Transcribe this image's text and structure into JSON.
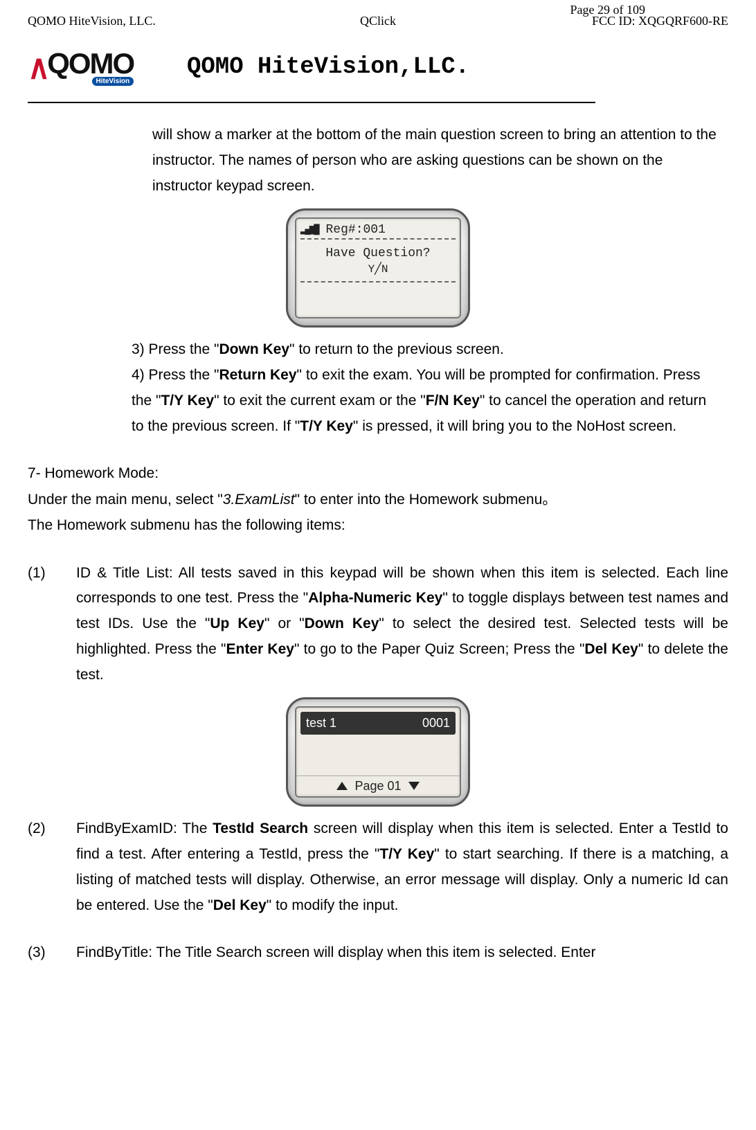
{
  "header": {
    "page_label": "Page ",
    "page_num": "29 of 109",
    "left": "QOMO HiteVision, LLC.",
    "center": "QClick",
    "right": "FCC ID: XQGQRF600-RE",
    "logo_main": "QOMO",
    "logo_sub": "HiteVision",
    "company_title": "QOMO HiteVision,LLC."
  },
  "intro_continued": "will show a marker at the bottom of the main question screen to bring an attention to the instructor. The names of person who are asking questions can be shown on the instructor keypad screen.",
  "screen1": {
    "top_signal": "▂▄▆█",
    "top_label": "Reg#:001",
    "line1": "Have  Question?",
    "line2": "Y╱N"
  },
  "step3_pre": "3) Press the \"",
  "step3_bold": "Down Key",
  "step3_post": "\" to return to the previous screen.",
  "step4": {
    "t1": " 4) Press the \"",
    "b1": "Return Key",
    "t2": "\" to exit the exam. You will be prompted for confirmation. Press the \"",
    "b2": "T/Y Key",
    "t3": "\" to exit the current exam or the \"",
    "b3": "F/N Key",
    "t4": "\" to cancel the operation and return to the previous screen. If \"",
    "b4": "T/Y Key",
    "t5": "\" is pressed, it will bring you to the NoHost screen."
  },
  "section7": {
    "heading": "7-  Homework Mode:",
    "line1_pre": "Under the main menu, select \"",
    "line1_italic": "3.ExamList",
    "line1_post": "\" to enter into the Homework submenu",
    "line1_end": "。",
    "line2": "The Homework submenu has the following items:"
  },
  "item1": {
    "num": "(1)",
    "t1": "ID & Title List: All tests saved in this keypad will be shown when this item is selected. Each line corresponds to one test. Press the \"",
    "b1": "Alpha-Numeric Key",
    "t2": "\" to toggle displays between test names and test IDs.    Use the \"",
    "b2": "Up Key",
    "t3": "\" or \"",
    "b3": "Down Key",
    "t4": "\" to select the desired test. Selected tests will be highlighted. Press the \"",
    "b4": "Enter Key",
    "t5": "\" to go to the Paper Quiz Screen; Press the \"",
    "b5": "Del Key",
    "t6": "\" to delete the test."
  },
  "screen2": {
    "row_name": "test 1",
    "row_id": "0001",
    "page_label": "Page 01"
  },
  "item2": {
    "num": "(2)",
    "t1": "FindByExamID: The ",
    "b1": "TestId Search",
    "t2": " screen will display when this item is selected. Enter a TestId to find a test. After entering a TestId, press the \"",
    "b2": "T/Y Key",
    "t3": "\" to start searching. If there is a matching, a listing of matched tests will display. Otherwise, an error message will display. Only a numeric Id can be entered. Use the \"",
    "b3": "Del Key",
    "t4": "\" to modify the input."
  },
  "item3": {
    "num": "(3)",
    "t1": "FindByTitle: The Title Search screen will display when this item is selected. Enter"
  }
}
